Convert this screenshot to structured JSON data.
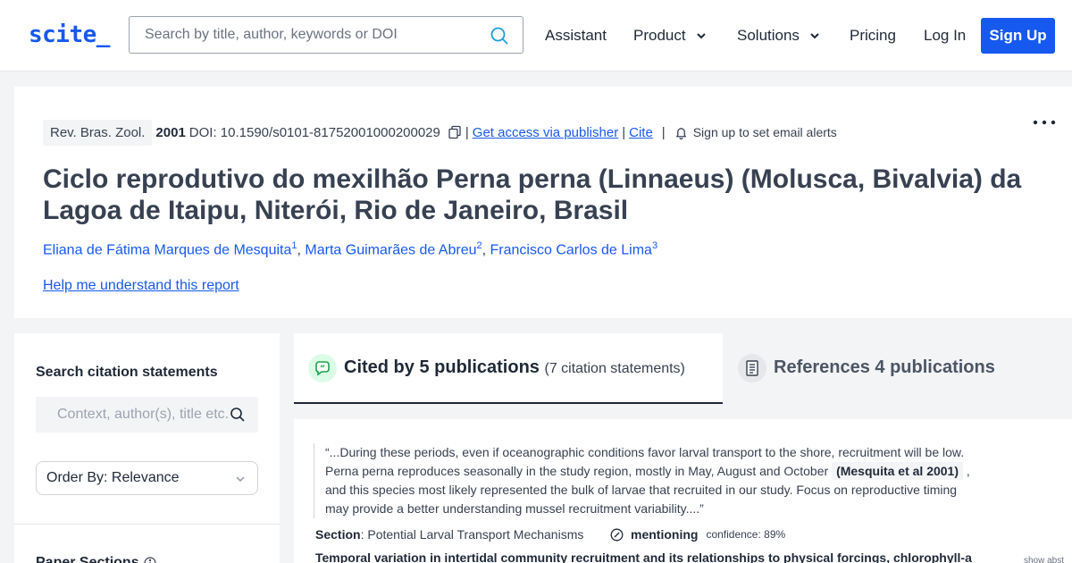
{
  "header": {
    "logo": "scite_",
    "search_placeholder": "Search by title, author, keywords or DOI",
    "nav": {
      "assistant": "Assistant",
      "product": "Product",
      "solutions": "Solutions",
      "pricing": "Pricing",
      "login": "Log In",
      "signup": "Sign Up"
    }
  },
  "paper": {
    "journal": "Rev. Bras. Zool.",
    "year": "2001",
    "doi": "DOI: 10.1590/s0101-81752001000200029",
    "separator": "|",
    "access_link": "Get access via publisher",
    "cite_link": "Cite",
    "alerts": "Sign up to set email alerts",
    "title": "Ciclo reprodutivo do mexilhão Perna perna (Linnaeus) (Molusca, Bivalvia) da Lagoa de Itaipu, Niterói, Rio de Janeiro, Brasil",
    "authors": [
      {
        "name": "Eliana de Fátima Marques de Mesquita",
        "sup": "1"
      },
      {
        "name": "Marta Guimarães de Abreu",
        "sup": "2"
      },
      {
        "name": "Francisco Carlos de Lima",
        "sup": "3"
      }
    ],
    "comma": ",",
    "help_link": "Help me understand this report"
  },
  "sidebar": {
    "heading": "Search citation statements",
    "search_placeholder": "Context, author(s), title etc.",
    "order_by": "Order By: Relevance",
    "paper_sections": "Paper Sections"
  },
  "tabs": {
    "cited_label": "Cited by 5 publications",
    "cited_count": "(7 citation statements)",
    "references_label": "References 4 publications"
  },
  "citation": {
    "quote_before": "“...During these periods, even if oceanographic conditions favor larval transport to the shore, recruitment will be low. Perna perna reproduces seasonally in the study region, mostly in May, August and October ",
    "quote_ref": "(Mesquita et al 2001)",
    "quote_after": " , and this species most likely represented the bulk of larvae that recruited in our study. Focus on reproductive timing may provide a better understanding mussel recruitment variability....”",
    "section_label": "Section",
    "section_value": ": Potential Larval Transport Mechanisms",
    "type": "mentioning",
    "confidence": "confidence: 89%",
    "next_title": "Temporal variation in intertidal community recruitment and its relationships to physical forcings, chlorophyll-a",
    "show_abstract": "show abst"
  },
  "colors": {
    "brand": "#1659ee",
    "cited_icon_bg": "#dcfce7"
  }
}
